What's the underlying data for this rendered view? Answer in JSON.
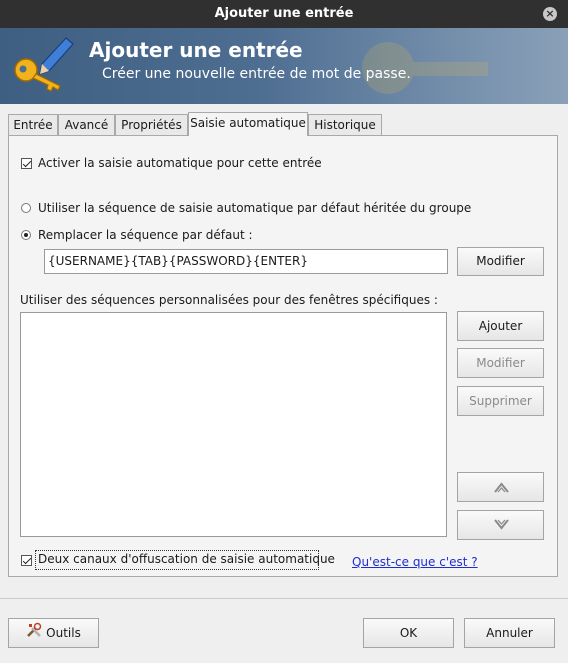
{
  "window": {
    "title": "Ajouter une entrée",
    "close_icon": "close-icon"
  },
  "banner": {
    "title": "Ajouter une entrée",
    "subtitle": "Créer une nouvelle entrée de mot de passe."
  },
  "tabs": [
    {
      "label": "Entrée"
    },
    {
      "label": "Avancé"
    },
    {
      "label": "Propriétés"
    },
    {
      "label": "Saisie automatique",
      "active": true
    },
    {
      "label": "Historique"
    }
  ],
  "autotype": {
    "enable_label": "Activer la saisie automatique pour cette entrée",
    "enable_checked": true,
    "inherit_label": "Utiliser la séquence de saisie automatique par défaut héritée du groupe",
    "override_label": "Remplacer la séquence par défaut :",
    "override_selected": true,
    "sequence_value": "{USERNAME}{TAB}{PASSWORD}{ENTER}",
    "modify_sequence_label": "Modifier",
    "custom_label": "Utiliser des séquences personnalisées pour des fenêtres spécifiques :",
    "add_label": "Ajouter",
    "edit_label": "Modifier",
    "delete_label": "Supprimer",
    "obfuscation_label": "Deux canaux d'offuscation de saisie automatique",
    "obfuscation_checked": true,
    "help_link": "Qu'est-ce que c'est ?"
  },
  "footer": {
    "tools_label": "Outils",
    "ok_label": "OK",
    "cancel_label": "Annuler"
  },
  "colors": {
    "titlebar": "#303030",
    "banner": "#4d6d91",
    "link": "#1f2dcf"
  }
}
